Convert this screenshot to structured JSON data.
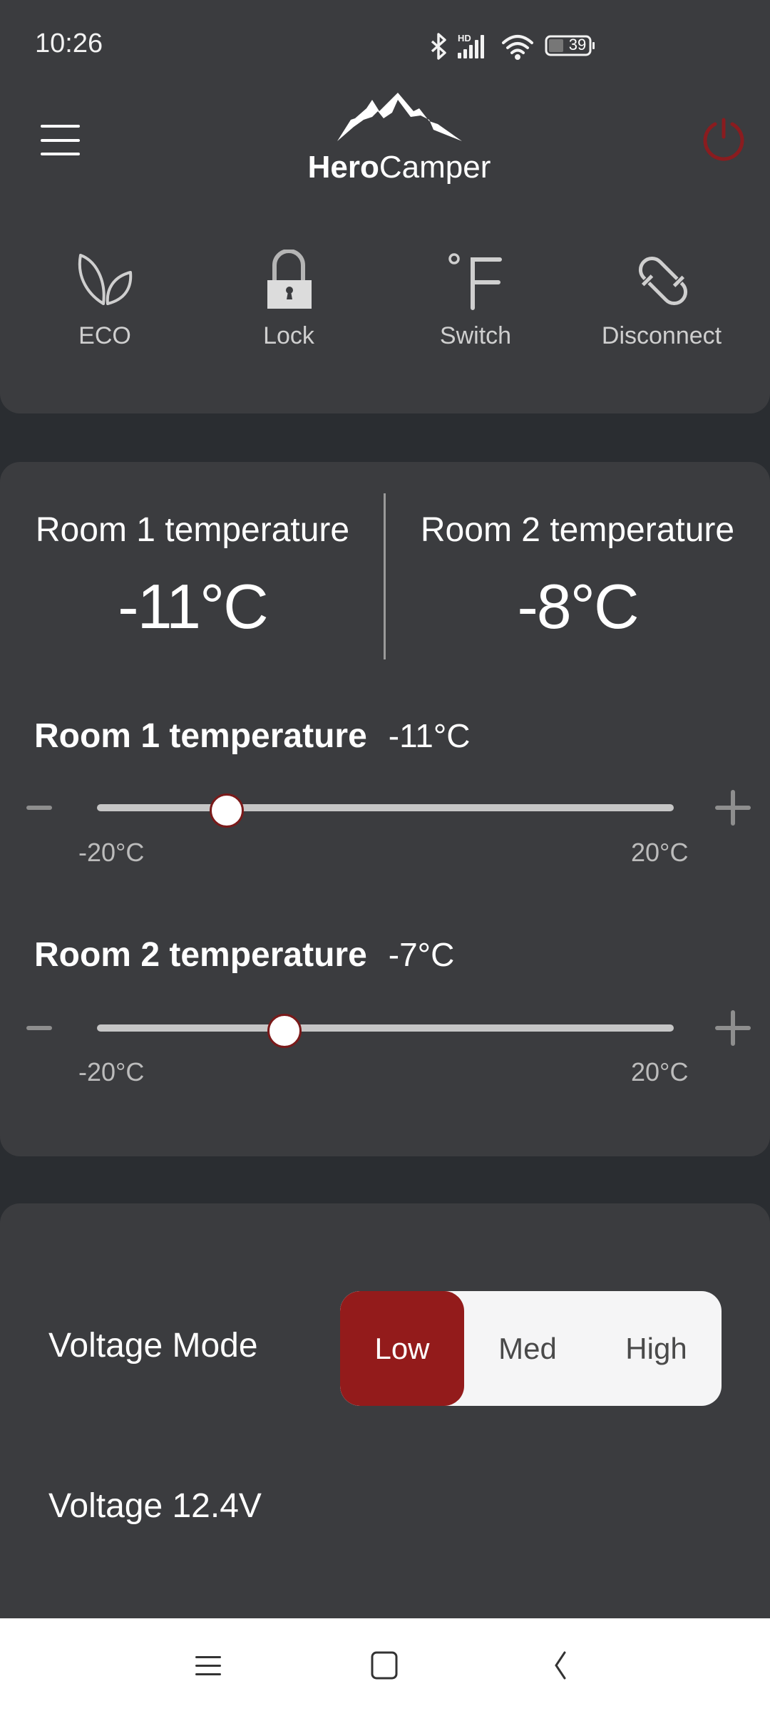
{
  "status_bar": {
    "time": "10:26",
    "battery_level": "39",
    "icons": [
      "bluetooth-icon",
      "hd-signal-icon",
      "wifi-icon",
      "battery-icon"
    ]
  },
  "header": {
    "brand_bold": "Hero",
    "brand_regular": "Camper",
    "menu_icon": "hamburger-menu-icon",
    "power_icon": "power-icon",
    "accent_color": "#931b1b"
  },
  "controls": [
    {
      "label": "ECO",
      "icon": "leaf-icon"
    },
    {
      "label": "Lock",
      "icon": "lock-icon"
    },
    {
      "label": "Switch",
      "icon": "fahrenheit-icon"
    },
    {
      "label": "Disconnect",
      "icon": "unlink-icon"
    }
  ],
  "current_temps": [
    {
      "label": "Room 1 temperature",
      "value": "-11°C"
    },
    {
      "label": "Room 2 temperature",
      "value": "-8°C"
    }
  ],
  "setpoints": [
    {
      "label": "Room 1 temperature",
      "value_text": "-11°C",
      "value": -11,
      "min": -20,
      "max": 20,
      "min_label": "-20°C",
      "max_label": "20°C"
    },
    {
      "label": "Room 2 temperature",
      "value_text": "-7°C",
      "value": -7,
      "min": -20,
      "max": 20,
      "min_label": "-20°C",
      "max_label": "20°C"
    }
  ],
  "voltage": {
    "mode_label": "Voltage Mode",
    "options": [
      "Low",
      "Med",
      "High"
    ],
    "selected": "Low",
    "reading": "Voltage 12.4V"
  },
  "nav_bar": {
    "icons": [
      "recents-icon",
      "home-icon",
      "back-icon"
    ]
  }
}
